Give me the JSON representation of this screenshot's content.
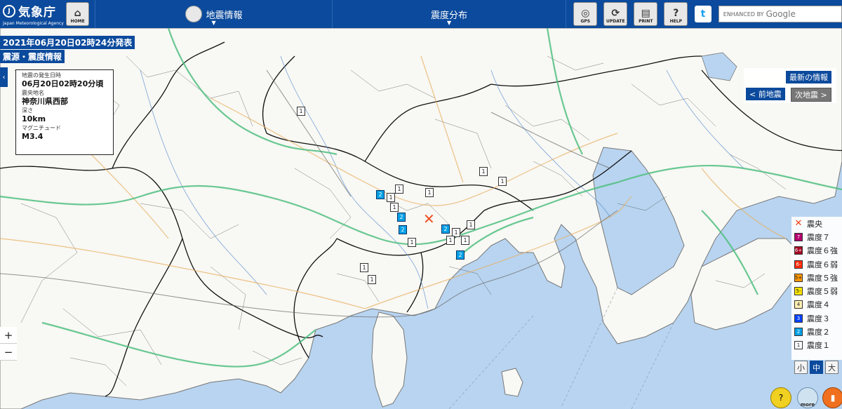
{
  "header": {
    "logo_jp": "気象庁",
    "logo_en": "Japan Meteorological Agency",
    "home_label": "HOME",
    "menu1_label": "地震情報",
    "menu2_label": "震度分布",
    "tools": [
      {
        "label": "GPS",
        "icon": "gps-icon"
      },
      {
        "label": "UPDATE",
        "icon": "update-icon"
      },
      {
        "label": "PRINT",
        "icon": "print-icon"
      },
      {
        "label": "HELP",
        "icon": "help-icon"
      }
    ],
    "search_prefix": "ENHANCED BY",
    "search_brand": "Google"
  },
  "banner": {
    "published": "2021年06月20日02時24分発表",
    "type": "震源・震度情報"
  },
  "quake": {
    "time_label": "地震の発生日時",
    "time": "06月20日02時20分頃",
    "place_label": "震央地名",
    "place": "神奈川県西部",
    "depth_label": "深さ",
    "depth": "10km",
    "mag_label": "マグニチュード",
    "mag": "M3.4"
  },
  "nav": {
    "latest": "最新の情報",
    "prev": "< 前地震",
    "next": "次地震 >"
  },
  "legend": {
    "epicenter": "震央",
    "items": [
      {
        "code": "7",
        "label": "震度７",
        "color": "#b4006e"
      },
      {
        "code": "6+",
        "label": "震度６強",
        "color": "#a50021"
      },
      {
        "code": "6-",
        "label": "震度６弱",
        "color": "#ff2800"
      },
      {
        "code": "5+",
        "label": "震度５強",
        "color": "#ff9900"
      },
      {
        "code": "5-",
        "label": "震度５弱",
        "color": "#ffe600"
      },
      {
        "code": "4",
        "label": "震度４",
        "color": "#fff0b4"
      },
      {
        "code": "3",
        "label": "震度３",
        "color": "#0041ff"
      },
      {
        "code": "2",
        "label": "震度２",
        "color": "#00a0e6"
      },
      {
        "code": "1",
        "label": "震度１",
        "color": "#ffffff"
      }
    ],
    "sizes": [
      "小",
      "中",
      "大"
    ]
  },
  "zoom": {
    "in": "+",
    "out": "−"
  },
  "bottom": {
    "more": "more"
  },
  "stations": [
    {
      "v": "1"
    },
    {
      "v": "1"
    },
    {
      "v": "2"
    },
    {
      "v": "1"
    },
    {
      "v": "1"
    },
    {
      "v": "1"
    },
    {
      "v": "2"
    },
    {
      "v": "2"
    },
    {
      "v": "1"
    },
    {
      "v": "2"
    },
    {
      "v": "1"
    },
    {
      "v": "1"
    },
    {
      "v": "1"
    },
    {
      "v": "1"
    },
    {
      "v": "2"
    },
    {
      "v": "1"
    },
    {
      "v": "1"
    },
    {
      "v": "1"
    },
    {
      "v": "1"
    }
  ]
}
